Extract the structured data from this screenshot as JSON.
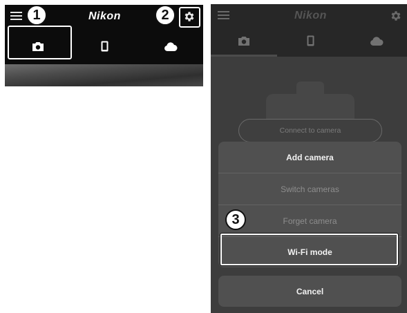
{
  "left_screen": {
    "header": {
      "brand": "Nikon",
      "menu_icon": "hamburger-menu-icon",
      "settings_icon": "gear-icon"
    },
    "tabs": [
      {
        "id": "camera",
        "icon": "camera-icon",
        "selected": true
      },
      {
        "id": "smart-device",
        "icon": "smartphone-icon",
        "selected": false
      },
      {
        "id": "cloud",
        "icon": "cloud-icon",
        "selected": false
      }
    ]
  },
  "callouts": {
    "one": "1",
    "two": "2",
    "three": "3"
  },
  "right_screen": {
    "header": {
      "brand": "Nikon",
      "menu_icon": "hamburger-menu-icon",
      "settings_icon": "gear-icon"
    },
    "tabs": [
      {
        "id": "camera",
        "icon": "camera-icon",
        "selected": true
      },
      {
        "id": "smart-device",
        "icon": "smartphone-icon",
        "selected": false
      },
      {
        "id": "cloud",
        "icon": "cloud-icon",
        "selected": false
      }
    ],
    "connect_button": "Connect to camera",
    "menu": {
      "items": [
        "Add camera",
        "Switch cameras",
        "Forget camera",
        "Wi-Fi mode"
      ],
      "cancel": "Cancel"
    }
  },
  "colors": {
    "highlight_border": "#ffffff",
    "callout_fill": "#ffffff",
    "enabled_text": "#f2f2f2",
    "disabled_text": "#8e8e8e"
  }
}
